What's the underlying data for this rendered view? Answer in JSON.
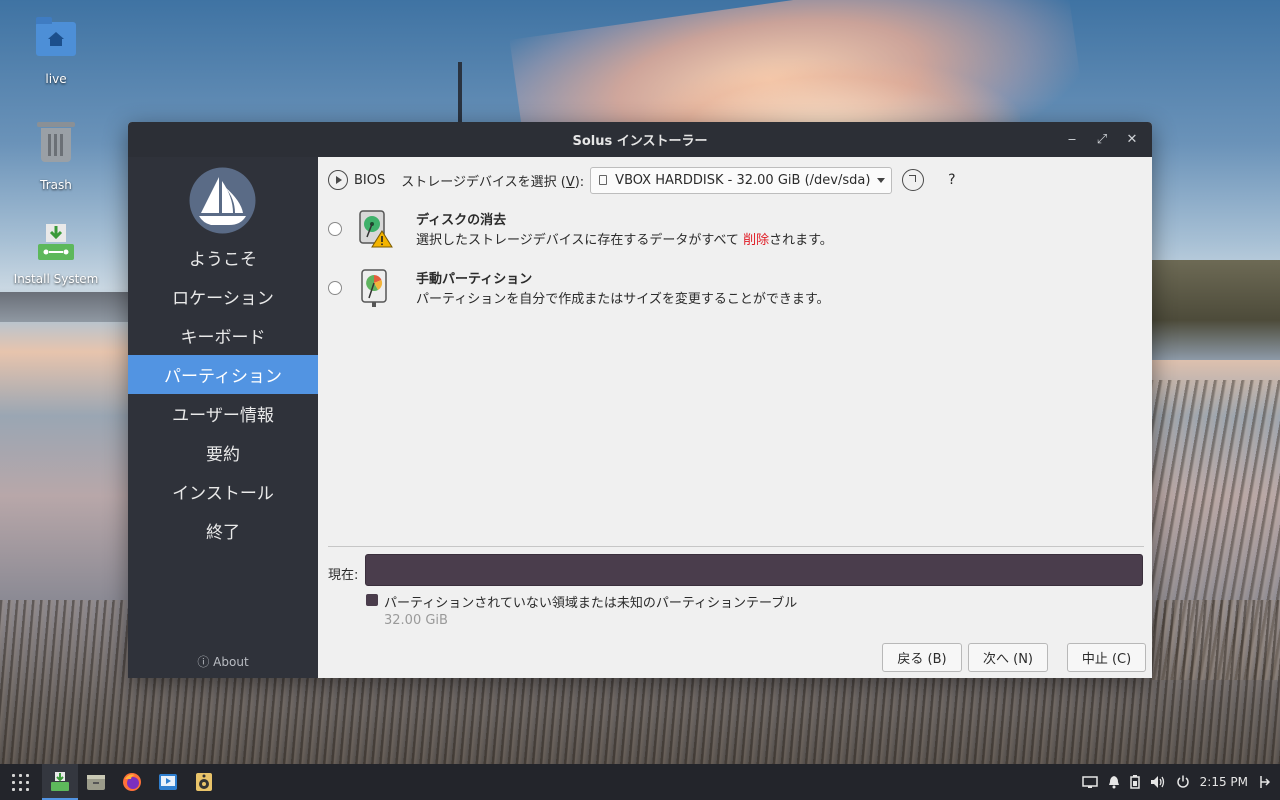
{
  "desktop": {
    "icons": [
      {
        "label": "live",
        "icon": "home-folder-icon"
      },
      {
        "label": "Trash",
        "icon": "trash-icon"
      },
      {
        "label": "Install System",
        "icon": "install-system-icon"
      }
    ]
  },
  "window": {
    "title": "Solus インストーラー",
    "controls": {
      "minimize": "‒",
      "maximize": "⤢",
      "close": "✕"
    }
  },
  "sidebar": {
    "items": [
      {
        "label": "ようこそ",
        "active": false
      },
      {
        "label": "ロケーション",
        "active": false
      },
      {
        "label": "キーボード",
        "active": false
      },
      {
        "label": "パーティション",
        "active": true
      },
      {
        "label": "ユーザー情報",
        "active": false
      },
      {
        "label": "要約",
        "active": false
      },
      {
        "label": "インストール",
        "active": false
      },
      {
        "label": "終了",
        "active": false
      }
    ],
    "about_label": "About",
    "about_icon": "ⓘ"
  },
  "partition": {
    "firmware": "BIOS",
    "device_label_prefix": "ストレージデバイスを選択 (",
    "device_label_key": "V",
    "device_label_suffix": "):",
    "device_selected": "VBOX HARDDISK - 32.00 GiB (/dev/sda)",
    "help": "?",
    "options": [
      {
        "title": "ディスクの消去",
        "desc_before": "選択したストレージデバイスに存在するデータがすべて ",
        "desc_highlight": "削除",
        "desc_after": "されます。"
      },
      {
        "title": "手動パーティション",
        "desc": "パーティションを自分で作成またはサイズを変更することができます。"
      }
    ],
    "current_label": "現在:",
    "legend": {
      "label": "パーティションされていない領域または未知のパーティションテーブル",
      "size": "32.00 GiB"
    },
    "colors": {
      "unpartitioned": "#4a3d4c",
      "highlight": "#e01b24",
      "accent": "#5294e2"
    }
  },
  "buttons": {
    "back": "戻る (B)",
    "next": "次へ (N)",
    "cancel": "中止 (C)"
  },
  "taskbar": {
    "clock": "2:15 PM",
    "apps": [
      "app-grid-icon",
      "installer-icon",
      "files-icon",
      "firefox-icon",
      "media-player-icon",
      "speaker-app-icon"
    ]
  }
}
